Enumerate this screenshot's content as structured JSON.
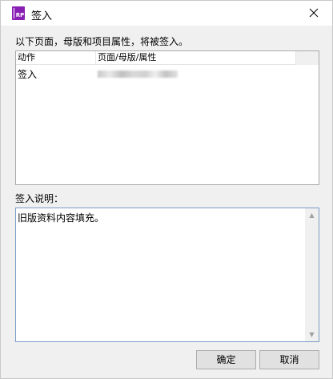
{
  "window": {
    "title": "签入",
    "app_icon_text": "RP",
    "close_symbol": "✕"
  },
  "instruction": "以下页面，母版和项目属性，将被签入。",
  "list": {
    "columns": [
      "动作",
      "页面/母版/属性",
      ""
    ],
    "rows": [
      {
        "action": "签入"
      }
    ]
  },
  "note": {
    "label": "签入说明：",
    "value": "旧版资料内容填充。"
  },
  "scrollbar": {
    "up_symbol": "▲",
    "down_symbol": "▼"
  },
  "buttons": {
    "ok_label": "确定",
    "cancel_label": "取消"
  }
}
